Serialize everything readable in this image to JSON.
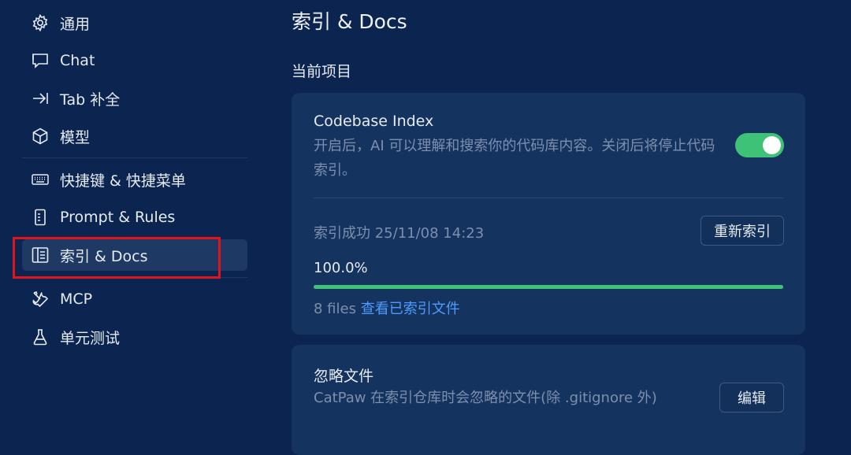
{
  "sidebar": {
    "items": [
      {
        "label": "通用",
        "icon": "gear-icon"
      },
      {
        "label": "Chat",
        "icon": "chat-icon"
      },
      {
        "label": "Tab 补全",
        "icon": "tab-arrow-icon"
      },
      {
        "label": "模型",
        "icon": "cube-icon"
      },
      {
        "label": "快捷键 & 快捷菜单",
        "icon": "keyboard-icon"
      },
      {
        "label": "Prompt & Rules",
        "icon": "document-icon"
      },
      {
        "label": "索引 & Docs",
        "icon": "book-icon",
        "active": true
      },
      {
        "label": "MCP",
        "icon": "tools-icon"
      },
      {
        "label": "单元测试",
        "icon": "flask-icon"
      }
    ]
  },
  "main": {
    "title": "索引 & Docs",
    "section": "当前项目",
    "codebase": {
      "title": "Codebase Index",
      "description": "开启后，AI 可以理解和搜索你的代码库内容。关闭后将停止代码索引。",
      "enabled": true,
      "status": "索引成功 25/11/08 14:23",
      "reindex_label": "重新索引",
      "progress_text": "100.0%",
      "progress": 1.0,
      "files_count": "8 files",
      "files_link": "查看已索引文件"
    },
    "ignore": {
      "title": "忽略文件",
      "description": "CatPaw 在索引仓库时会忽略的文件(除 .gitignore 外)",
      "edit_label": "编辑"
    }
  },
  "colors": {
    "background": "#0c2550",
    "card": "#15335f",
    "accent_green": "#3ec277",
    "link_blue": "#4e9bff",
    "highlight_red": "#e0151b"
  }
}
